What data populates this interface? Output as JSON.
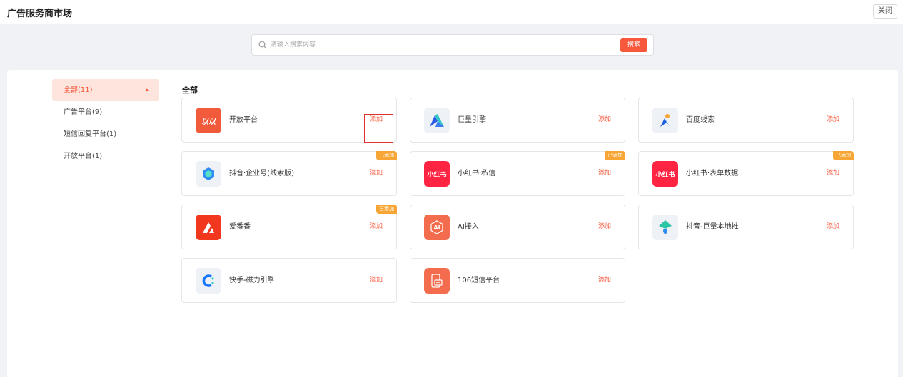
{
  "header": {
    "title": "广告服务商市场",
    "close_label": "关闭"
  },
  "search": {
    "placeholder": "请输入搜索内容",
    "value": "",
    "button_label": "搜索"
  },
  "sidebar": {
    "items": [
      {
        "label": "全部(11)",
        "active": true
      },
      {
        "label": "广告平台(9)",
        "active": false
      },
      {
        "label": "短信回复平台(1)",
        "active": false
      },
      {
        "label": "开放平台(1)",
        "active": false
      }
    ]
  },
  "main": {
    "section_title": "全部",
    "cards": [
      {
        "name": "开放平台",
        "action": "添加",
        "badge": "",
        "icon": "open-platform-logo",
        "icon_text": "以以",
        "color": "#f25a3c"
      },
      {
        "name": "巨量引擎",
        "action": "添加",
        "badge": "",
        "icon": "ocean-engine-logo",
        "icon_text": "",
        "color": "#eef1f6"
      },
      {
        "name": "百度线索",
        "action": "添加",
        "badge": "",
        "icon": "baidu-leads-logo",
        "icon_text": "",
        "color": "#eef1f6"
      },
      {
        "name": "抖音·企业号(线索版)",
        "action": "添加",
        "badge": "已添加",
        "icon": "douyin-enterprise-logo",
        "icon_text": "",
        "color": "#eef1f6"
      },
      {
        "name": "小红书·私信",
        "action": "添加",
        "badge": "已添加",
        "icon": "xiaohongshu-logo",
        "icon_text": "小红书",
        "color": "#ff2442"
      },
      {
        "name": "小红书·表单数据",
        "action": "添加",
        "badge": "已添加",
        "icon": "xiaohongshu-logo",
        "icon_text": "小红书",
        "color": "#ff2442"
      },
      {
        "name": "爱番番",
        "action": "添加",
        "badge": "已添加",
        "icon": "aifanfan-logo",
        "icon_text": "",
        "color": "#f2371f"
      },
      {
        "name": "AI接入",
        "action": "添加",
        "badge": "",
        "icon": "ai-access-logo",
        "icon_text": "AI",
        "color": "#f46c4e"
      },
      {
        "name": "抖音-巨量本地推",
        "action": "添加",
        "badge": "",
        "icon": "local-push-logo",
        "icon_text": "",
        "color": "#eef1f6"
      },
      {
        "name": "快手-磁力引擎",
        "action": "添加",
        "badge": "",
        "icon": "kuaishou-magnetic-logo",
        "icon_text": "",
        "color": "#eef1f6"
      },
      {
        "name": "106短信平台",
        "action": "添加",
        "badge": "",
        "icon": "sms-106-logo",
        "icon_text": "",
        "color": "#f46c4e"
      }
    ]
  },
  "colors": {
    "accent": "#f7573a",
    "badge": "#f7a535",
    "highlight": "#e03030"
  }
}
